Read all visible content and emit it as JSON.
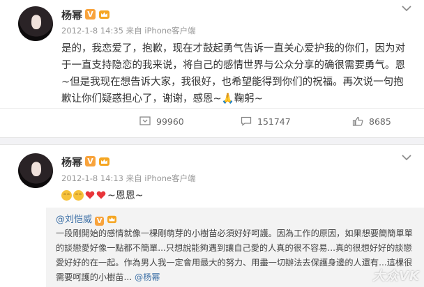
{
  "post1": {
    "author": "杨幂",
    "verified": "V",
    "meta": "2012-1-8 14:35 来自 iPhone客户端",
    "text": "是的，我恋爱了，抱歉，现在才鼓起勇气告诉一直关心爱护我的你们，因为对于一直支持隐恋的我来说，将自己的感情世界与公众分享的确很需要勇气。恩~但是我现在想告诉大家，我很好，也希望能得到你们的祝福。再次说一句抱歉让你们疑惑担心了，谢谢，感恩~🙏鞠躬~",
    "repost_count": "99960",
    "comment_count": "151747",
    "like_count": "8685"
  },
  "post2": {
    "author": "杨幂",
    "verified": "V",
    "meta": "2012-1-8 14:13 来自 iPhone客户端",
    "text": "~恩恩~",
    "quote": {
      "author": "@刘恺威",
      "text_main": "一段剛開始的感情就像一棵剛萌芽的小樹苗必須好好呵護。因為工作的原因，如果想要簡簡單單的談戀愛好像一點都不簡單...只想說能夠遇到讓自己愛的人真的很不容易...真的很想好好的談戀愛好好的在一起。作為男人我一定會用最大的努力、用盡一切辦法去保護身邊的人還有...這棵很需要呵護的小樹苗... ",
      "mention": "@杨幂"
    }
  },
  "watermark": "大众VK",
  "colors": {
    "link": "#3a6ea5",
    "meta": "#999999",
    "badge": "#f8a33c",
    "heart": "#e8353a"
  }
}
